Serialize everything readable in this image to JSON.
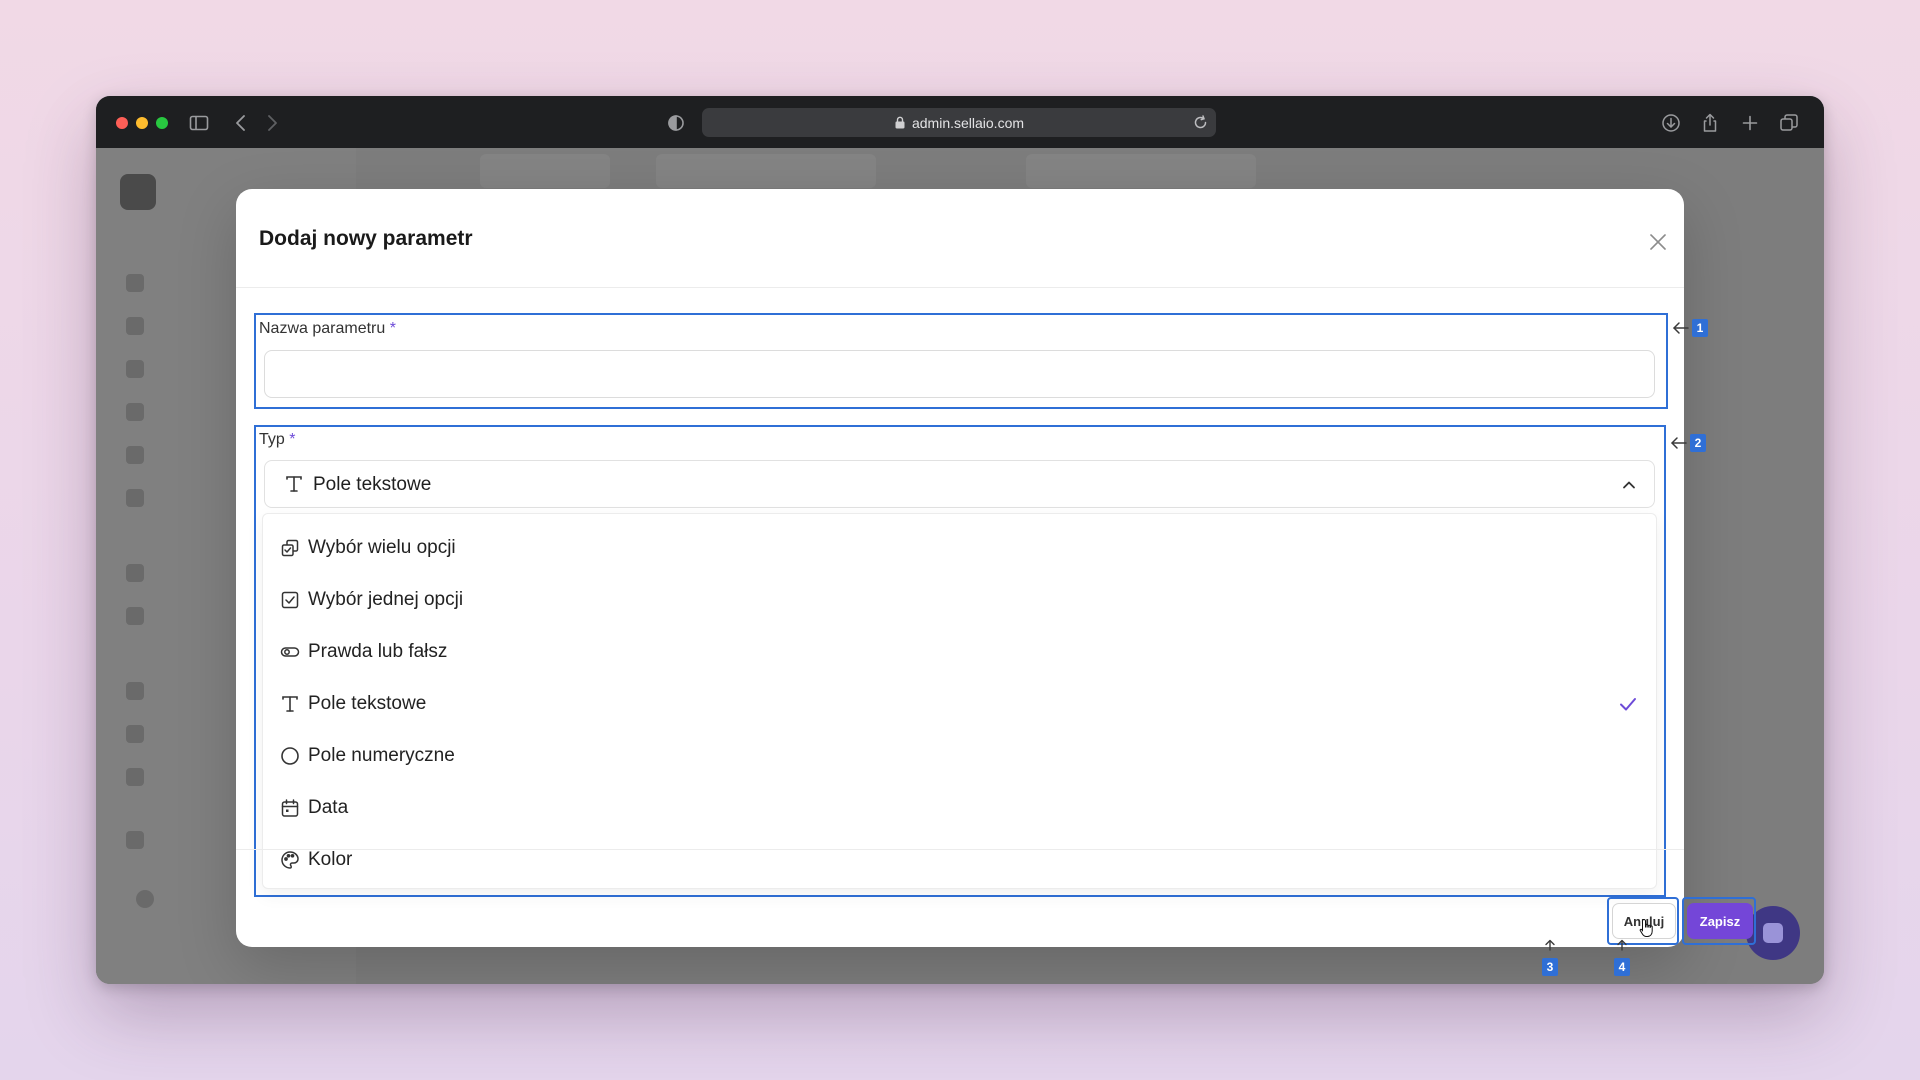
{
  "browser": {
    "url": "admin.sellaio.com",
    "icons": [
      "sidebar-icon",
      "back-icon",
      "forward-icon",
      "shield-icon",
      "lock-icon",
      "reload-icon",
      "download-icon",
      "share-icon",
      "new-tab-icon",
      "tabs-overview-icon"
    ]
  },
  "modal": {
    "title": "Dodaj nowy parametr",
    "name_field": {
      "label": "Nazwa parametru",
      "required_mark": "*",
      "value": "",
      "placeholder": ""
    },
    "type_field": {
      "label": "Typ",
      "required_mark": "*",
      "selected": "Pole tekstowe",
      "selected_icon": "text-type-icon",
      "expanded": true
    },
    "type_options": [
      {
        "label": "Wybór wielu opcji",
        "icon": "multi-select-icon",
        "selected": false
      },
      {
        "label": "Wybór jednej opcji",
        "icon": "checkbox-icon",
        "selected": false
      },
      {
        "label": "Prawda lub fałsz",
        "icon": "toggle-icon",
        "selected": false
      },
      {
        "label": "Pole tekstowe",
        "icon": "text-type-icon",
        "selected": true
      },
      {
        "label": "Pole numeryczne",
        "icon": "circle-icon",
        "selected": false
      },
      {
        "label": "Data",
        "icon": "calendar-icon",
        "selected": false
      },
      {
        "label": "Kolor",
        "icon": "palette-icon",
        "selected": false
      }
    ],
    "buttons": {
      "cancel": "Anuluj",
      "save": "Zapisz"
    }
  },
  "annotations": {
    "callout_1": "1",
    "callout_2": "2",
    "callout_3": "3",
    "callout_4": "4"
  },
  "colors": {
    "accent": "#7446d8",
    "highlight": "#2f6fd6",
    "check": "#6d4bd8",
    "titlebar": "#1e1f21"
  }
}
